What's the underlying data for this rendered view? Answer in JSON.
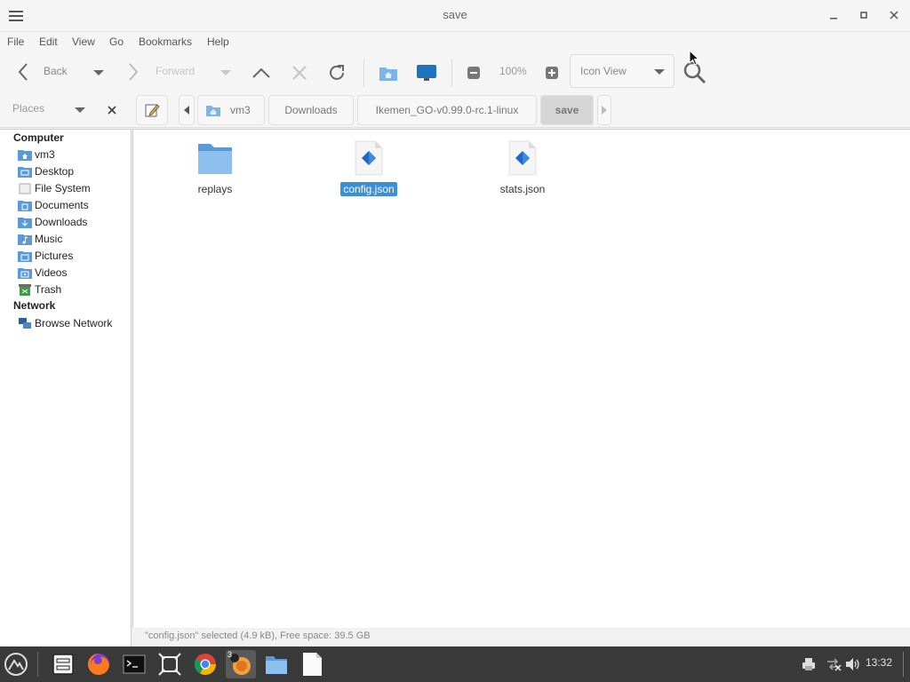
{
  "window": {
    "title": "save"
  },
  "menubar": [
    "File",
    "Edit",
    "View",
    "Go",
    "Bookmarks",
    "Help"
  ],
  "toolbar": {
    "back_label": "Back",
    "forward_label": "Forward",
    "zoom": "100%",
    "view_mode": "Icon View"
  },
  "places_label": "Places",
  "breadcrumbs": [
    "vm3",
    "Downloads",
    "Ikemen_GO-v0.99.0-rc.1-linux",
    "save"
  ],
  "sidebar": {
    "computer_header": "Computer",
    "computer_items": [
      "vm3",
      "Desktop",
      "File System",
      "Documents",
      "Downloads",
      "Music",
      "Pictures",
      "Videos",
      "Trash"
    ],
    "network_header": "Network",
    "network_items": [
      "Browse Network"
    ]
  },
  "files": [
    {
      "name": "replays",
      "type": "folder",
      "selected": false
    },
    {
      "name": "config.json",
      "type": "json",
      "selected": true
    },
    {
      "name": "stats.json",
      "type": "json",
      "selected": false
    }
  ],
  "status": "\"config.json\" selected (4.9 kB), Free space: 39.5 GB",
  "taskbar": {
    "clock": "13:32",
    "badge": "3"
  },
  "colors": {
    "selection": "#3b8ed8",
    "folder": "#7fb4e8",
    "taskbar": "#3a3a3a"
  }
}
